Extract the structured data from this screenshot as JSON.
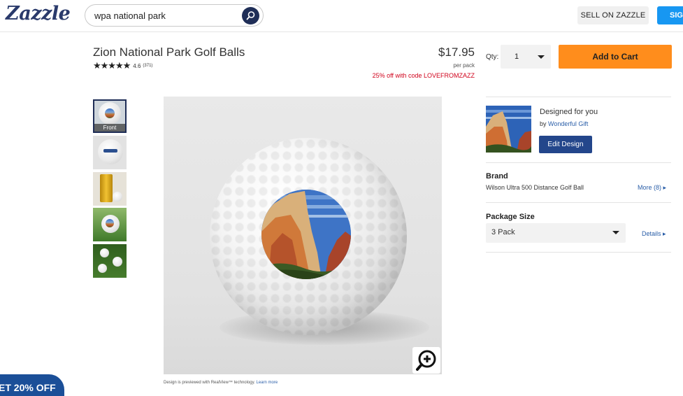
{
  "header": {
    "logo": "Zazzle",
    "search_value": "wpa national park",
    "sell_label": "SELL ON ZAZZLE",
    "sign_label": "SIG"
  },
  "product": {
    "title": "Zion National Park Golf Balls",
    "stars": "★★★★★",
    "rating": "4.6",
    "rating_count": "(371)",
    "price": "$17.95",
    "per_pack": "per pack",
    "promo": "25% off with code LOVEFROMZAZZ"
  },
  "purchase": {
    "qty_label": "Qty:",
    "qty_value": "1",
    "add_to_cart": "Add to Cart"
  },
  "gallery": {
    "thumbs": [
      {
        "label": "Front"
      }
    ],
    "caption": "Design is previewed with RealView™ technology.",
    "caption_link": "Learn more"
  },
  "designer": {
    "heading": "Designed for you",
    "by": "by",
    "name": "Wonderful Gift",
    "edit_label": "Edit Design"
  },
  "brand": {
    "heading": "Brand",
    "value": "Wilson Ultra 500 Distance Golf Ball",
    "more": "More (8) ▸"
  },
  "package": {
    "heading": "Package Size",
    "value": "3 Pack",
    "details": "Details ▸"
  },
  "promo_tab": {
    "label": "ET 20% OFF"
  },
  "colors": {
    "brand_navy": "#1f2e57",
    "cart_orange": "#ff8d1c",
    "promo_red": "#d0021b",
    "link_blue": "#2a5ea8"
  },
  "icons": [
    "search-icon",
    "zoom-in-icon",
    "chevron-down-icon"
  ]
}
